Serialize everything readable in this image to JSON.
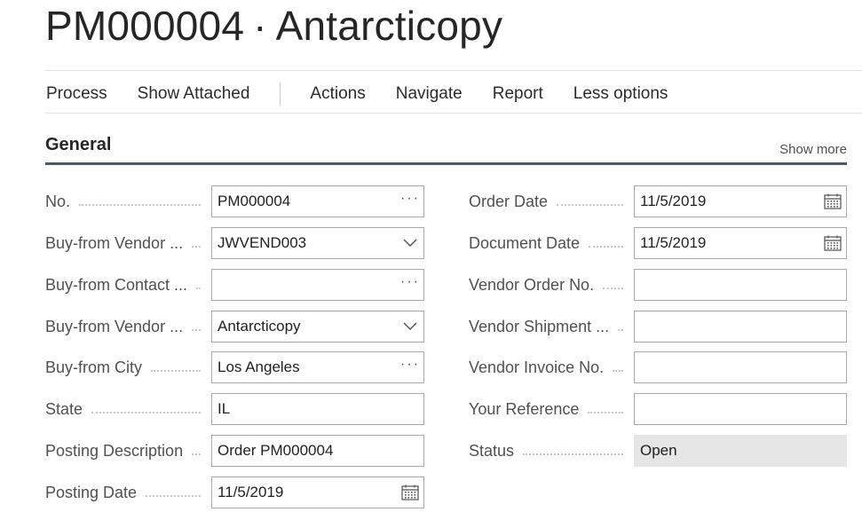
{
  "header": {
    "doc_no": "PM000004",
    "separator": "·",
    "vendor_name": "Antarcticopy"
  },
  "actions": {
    "process": "Process",
    "show_attached": "Show Attached",
    "actions": "Actions",
    "navigate": "Navigate",
    "report": "Report",
    "less_options": "Less options"
  },
  "section": {
    "title": "General",
    "show_more": "Show more"
  },
  "left_fields": [
    {
      "label": "No.",
      "value": "PM000004",
      "icon": "ellipsis-icon"
    },
    {
      "label": "Buy-from Vendor ...",
      "value": "JWVEND003",
      "icon": "chevron-down-icon"
    },
    {
      "label": "Buy-from Contact ...",
      "value": "",
      "icon": "ellipsis-icon"
    },
    {
      "label": "Buy-from Vendor ...",
      "value": "Antarcticopy",
      "icon": "chevron-down-icon"
    },
    {
      "label": "Buy-from City",
      "value": "Los Angeles",
      "icon": "ellipsis-icon"
    },
    {
      "label": "State",
      "value": "IL",
      "icon": ""
    },
    {
      "label": "Posting Description",
      "value": "Order PM000004",
      "icon": ""
    },
    {
      "label": "Posting Date",
      "value": "11/5/2019",
      "icon": "calendar-icon"
    }
  ],
  "right_fields": [
    {
      "label": "Order Date",
      "value": "11/5/2019",
      "icon": "calendar-icon"
    },
    {
      "label": "Document Date",
      "value": "11/5/2019",
      "icon": "calendar-icon"
    },
    {
      "label": "Vendor Order No.",
      "value": "",
      "icon": ""
    },
    {
      "label": "Vendor Shipment ...",
      "value": "",
      "icon": ""
    },
    {
      "label": "Vendor Invoice No.",
      "value": "",
      "icon": ""
    },
    {
      "label": "Your Reference",
      "value": "",
      "icon": ""
    },
    {
      "label": "Status",
      "value": "Open",
      "icon": ""
    }
  ]
}
